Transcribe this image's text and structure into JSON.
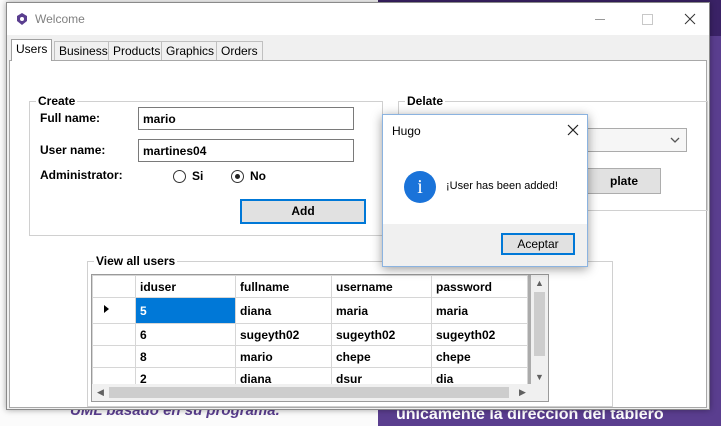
{
  "window": {
    "title": "Welcome"
  },
  "tabs": [
    "Users",
    "Business",
    "Products",
    "Graphics",
    "Orders"
  ],
  "create": {
    "title": "Create",
    "fullname_label": "Full name:",
    "fullname_value": "mario",
    "username_label": "User name:",
    "username_value": "martines04",
    "admin_label": "Administrator:",
    "opt_si": "Si",
    "opt_no": "No",
    "selected": "No",
    "add_label": "Add"
  },
  "delate": {
    "title": "Delate",
    "button_label": "plate"
  },
  "grid": {
    "title": "View all users",
    "columns": [
      "iduser",
      "fullname",
      "username",
      "password"
    ],
    "rows": [
      [
        "5",
        "diana",
        "maria",
        "maria"
      ],
      [
        "6",
        "sugeyth02",
        "sugeyth02",
        "sugeyth02"
      ],
      [
        "8",
        "mario",
        "chepe",
        "chepe"
      ],
      [
        "2",
        "diana",
        "dsur",
        "dia"
      ]
    ]
  },
  "dialog": {
    "title": "Hugo",
    "message": "¡User has been added!",
    "ok_label": "Aceptar"
  },
  "background": {
    "footer_left": "UML basado en su programa.",
    "footer_right": "únicamente la dirección del tablero"
  },
  "colors": {
    "accent": "#0078d7",
    "bg_purple": "#5a3e8f",
    "info_blue": "#1a73d9"
  }
}
